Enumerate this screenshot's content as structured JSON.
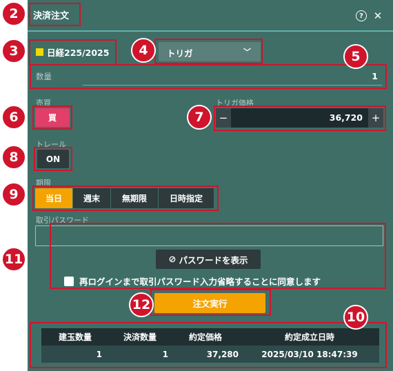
{
  "header": {
    "title": "決済注文",
    "help_icon": "question-circle-icon",
    "close_icon": "close-icon"
  },
  "symbol": {
    "name": "日経225/2025",
    "color": "#f0d800"
  },
  "order_type": {
    "selected": "トリガ"
  },
  "quantity": {
    "label": "数量",
    "value": "1"
  },
  "side": {
    "label": "売買",
    "value": "買",
    "color": "#e23e6a"
  },
  "trigger_price": {
    "label": "トリガ価格",
    "value": "36,720",
    "minus": "−",
    "plus": "+"
  },
  "trail": {
    "label": "トレール",
    "value": "ON"
  },
  "period": {
    "label": "期限",
    "options": [
      "当日",
      "週末",
      "無期限",
      "日時指定"
    ],
    "selected": "当日"
  },
  "password": {
    "label": "取引パスワード",
    "value": "",
    "show_label": "パスワードを表示",
    "consent_label": "再ログインまで取引パスワード入力省略することに同意します"
  },
  "execute": {
    "label": "注文実行",
    "color": "#f5a300"
  },
  "positions": {
    "headers": [
      "建玉数量",
      "決済数量",
      "約定価格",
      "約定成立日時"
    ],
    "rows": [
      [
        "1",
        "1",
        "37,280",
        "2025/03/10 18:47:39"
      ]
    ]
  },
  "callouts": [
    "2",
    "3",
    "4",
    "5",
    "6",
    "7",
    "8",
    "9",
    "10",
    "11",
    "12"
  ],
  "colors": {
    "panel": "#3f6e67",
    "callout": "#d0142c",
    "accent": "#5fb3a9"
  }
}
